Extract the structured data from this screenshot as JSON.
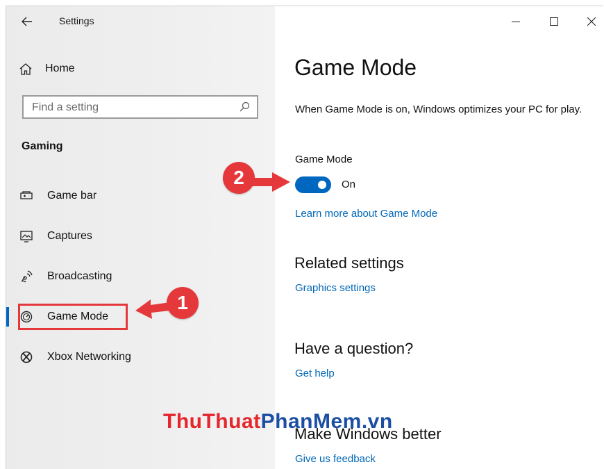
{
  "window": {
    "title": "Settings",
    "back_icon": "back-arrow-icon",
    "controls": [
      "minimize-icon",
      "maximize-icon",
      "close-icon"
    ]
  },
  "sidebar": {
    "home_label": "Home",
    "search_placeholder": "Find a setting",
    "section": "Gaming",
    "items": [
      {
        "label": "Game bar",
        "icon": "game-bar-icon"
      },
      {
        "label": "Captures",
        "icon": "captures-icon"
      },
      {
        "label": "Broadcasting",
        "icon": "broadcasting-icon"
      },
      {
        "label": "Game Mode",
        "icon": "game-mode-icon",
        "selected": true
      },
      {
        "label": "Xbox Networking",
        "icon": "xbox-icon"
      }
    ]
  },
  "main": {
    "title": "Game Mode",
    "description": "When Game Mode is on, Windows optimizes your PC for play.",
    "toggle_label": "Game Mode",
    "toggle_state": "On",
    "learn_more": "Learn more about Game Mode",
    "related_heading": "Related settings",
    "related_link": "Graphics settings",
    "question_heading": "Have a question?",
    "help_link": "Get help",
    "better_heading": "Make Windows better",
    "feedback_link": "Give us feedback"
  },
  "annotations": {
    "step1": "1",
    "step2": "2",
    "accent_color": "#e5383b"
  },
  "watermark": {
    "part1": "ThuThuat",
    "part2": "PhanMem",
    "part3": ".vn"
  },
  "colors": {
    "accent": "#0067c0",
    "link": "#0067b8",
    "sidebar_bg": "#ececec"
  }
}
